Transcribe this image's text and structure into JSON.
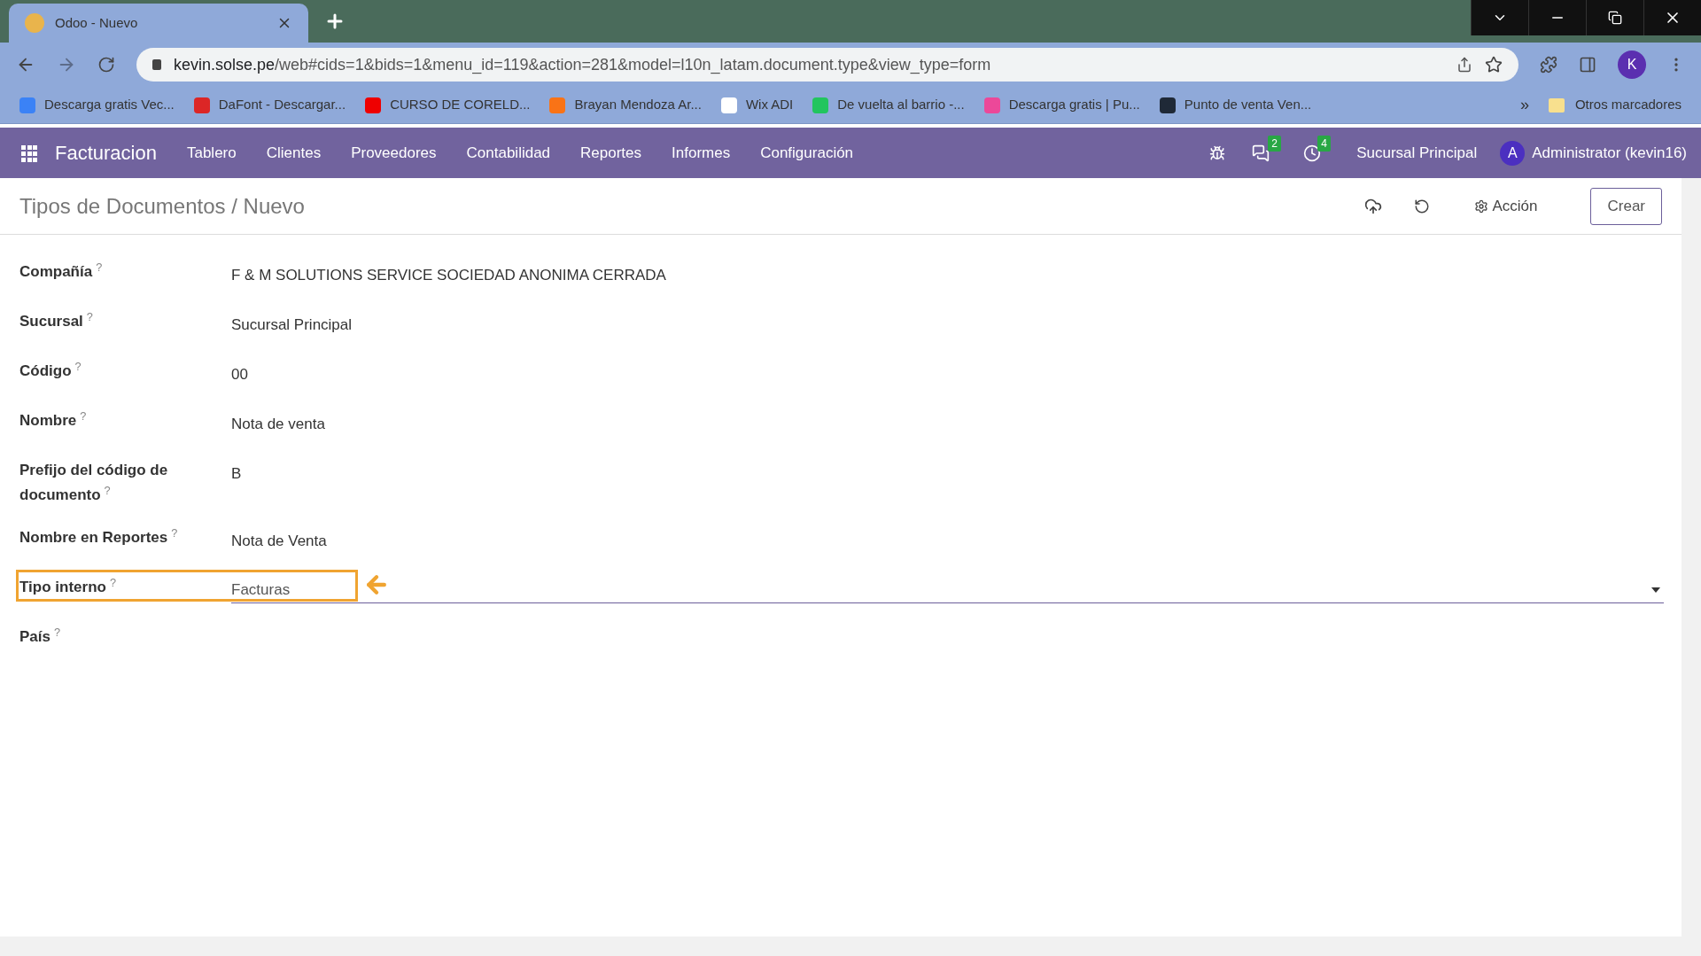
{
  "browser": {
    "tab": {
      "title": "Odoo - Nuevo"
    },
    "url": {
      "host": "kevin.solse.pe",
      "path": "/web#cids=1&bids=1&menu_id=119&action=281&model=l10n_latam.document.type&view_type=form"
    },
    "avatar": "K",
    "bookmarks": [
      {
        "label": "Descarga gratis Vec...",
        "color": "#3b82f6"
      },
      {
        "label": "DaFont - Descargar...",
        "color": "#dc2626"
      },
      {
        "label": "CURSO DE CORELD...",
        "color": "#ef0000"
      },
      {
        "label": "Brayan Mendoza Ar...",
        "color": "#f97316"
      },
      {
        "label": "Wix ADI",
        "color": "#ffffff"
      },
      {
        "label": "De vuelta al barrio -...",
        "color": "#22c55e"
      },
      {
        "label": "Descarga gratis | Pu...",
        "color": "#ec4899"
      },
      {
        "label": "Punto de venta Ven...",
        "color": "#1f2937"
      }
    ],
    "more": "»",
    "other_bookmarks": "Otros marcadores"
  },
  "navbar": {
    "app": "Facturacion",
    "menu": [
      "Tablero",
      "Clientes",
      "Proveedores",
      "Contabilidad",
      "Reportes",
      "Informes",
      "Configuración"
    ],
    "messages_count": "2",
    "activities_count": "4",
    "branch": "Sucursal Principal",
    "user_initial": "A",
    "user": "Administrator (kevin16)"
  },
  "control_panel": {
    "breadcrumb": "Tipos de Documentos / Nuevo",
    "action": "Acción",
    "create": "Crear"
  },
  "form": {
    "fields": [
      {
        "label": "Compañía",
        "value": "F & M SOLUTIONS SERVICE SOCIEDAD ANONIMA CERRADA",
        "kind": "text",
        "highlighted": false
      },
      {
        "label": "Sucursal",
        "value": "Sucursal Principal",
        "kind": "text",
        "highlighted": false
      },
      {
        "label": "Código",
        "value": "00",
        "kind": "text",
        "highlighted": false
      },
      {
        "label": "Nombre",
        "value": "Nota de venta",
        "kind": "text",
        "highlighted": false
      },
      {
        "label": "Prefijo del código de documento",
        "value": "B",
        "kind": "text",
        "highlighted": false
      },
      {
        "label": "Nombre en Reportes",
        "value": "Nota de Venta",
        "kind": "text",
        "highlighted": false
      },
      {
        "label": "Tipo interno",
        "value": "Facturas",
        "kind": "select",
        "highlighted": true
      },
      {
        "label": "País",
        "kind": "text",
        "highlighted": false
      }
    ],
    "help_mark": "?"
  }
}
